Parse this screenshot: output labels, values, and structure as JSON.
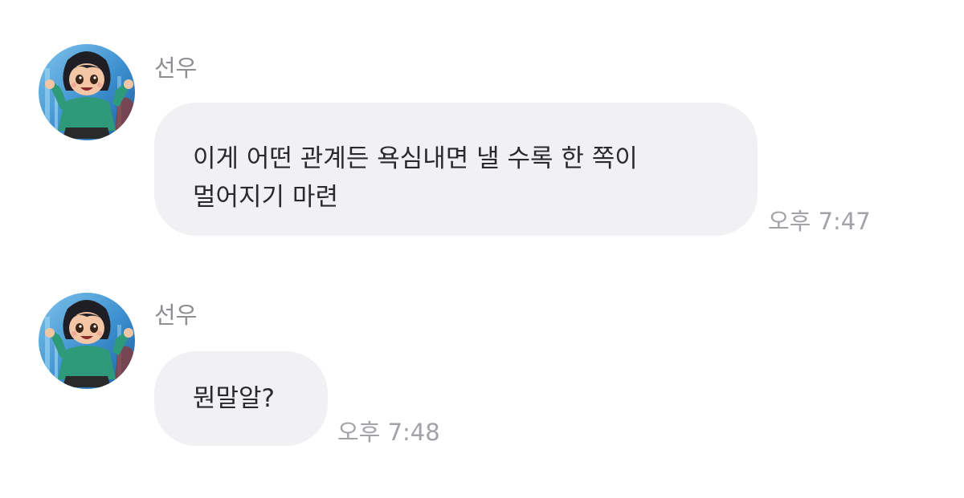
{
  "messages": [
    {
      "sender": "선우",
      "avatar": "profile-avatar-cartoon-girl",
      "lines": [
        "이게 어떤 관계든 욕심내면 낼 수록 한 쪽이",
        "멀어지기 마련"
      ],
      "time": "오후 7:47"
    },
    {
      "sender": "선우",
      "avatar": "profile-avatar-cartoon-girl",
      "lines": [
        "뭔말알?"
      ],
      "time": "오후 7:48"
    }
  ],
  "colors": {
    "bubble": "#f1f1f4",
    "message_text": "#2a2a2c",
    "sender_text": "#8e8e93",
    "time_text": "#a2a2a7"
  }
}
